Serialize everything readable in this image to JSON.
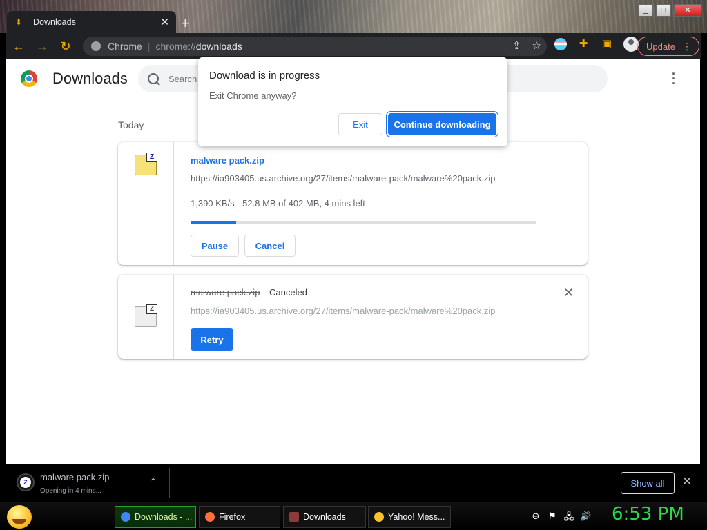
{
  "window": {
    "tab_title": "Downloads",
    "tab_close": "✕",
    "new_tab": "+",
    "min": "_",
    "max": "□",
    "close": "✕"
  },
  "toolbar": {
    "back": "←",
    "forward": "→",
    "reload": "↻",
    "omnibox_scheme": "Chrome",
    "omnibox_sep": "|",
    "omnibox_url_prefix": "chrome://",
    "omnibox_url_main": "downloads",
    "update_label": "Update",
    "menu": "⋮"
  },
  "page": {
    "title": "Downloads",
    "search_placeholder": "Search downloads",
    "date_heading": "Today",
    "downloads": [
      {
        "name": "malware pack.zip",
        "url": "https://ia903405.us.archive.org/27/items/malware-pack/malware%20pack.zip",
        "progress_text": "1,390 KB/s - 52.8 MB of 402 MB, 4 mins left",
        "progress_fraction": 0.131,
        "pause_label": "Pause",
        "cancel_label": "Cancel",
        "icon_letter": "Z"
      },
      {
        "name": "malware pack.zip",
        "status": "Canceled",
        "url": "https://ia903405.us.archive.org/27/items/malware-pack/malware%20pack.zip",
        "retry_label": "Retry",
        "remove_label": "✕",
        "icon_letter": "Z"
      }
    ]
  },
  "dialog": {
    "title": "Download is in progress",
    "message": "Exit Chrome anyway?",
    "exit_label": "Exit",
    "continue_label": "Continue downloading"
  },
  "shelf": {
    "file_name": "malware pack.zip",
    "sub_text": "Opening in 4 mins...",
    "chevron": "⌃",
    "show_all_label": "Show all",
    "close": "✕",
    "icon_letter": "Z"
  },
  "taskbar": {
    "tasks": [
      {
        "label": "Downloads - ...",
        "icon_color": "#4285f4"
      },
      {
        "label": "Firefox",
        "icon_color": "#ff7139"
      },
      {
        "label": "Downloads",
        "icon_color": "#8b3a3a"
      },
      {
        "label": "Yahoo! Mess...",
        "icon_color": "#fbc02d"
      }
    ],
    "tray": [
      "⊖",
      "⚑",
      "🖧",
      "🔊"
    ],
    "clock": "6:53 PM"
  },
  "colors": {
    "accent": "#1a73e8",
    "update": "#f28b82",
    "clock": "#32d74b"
  }
}
